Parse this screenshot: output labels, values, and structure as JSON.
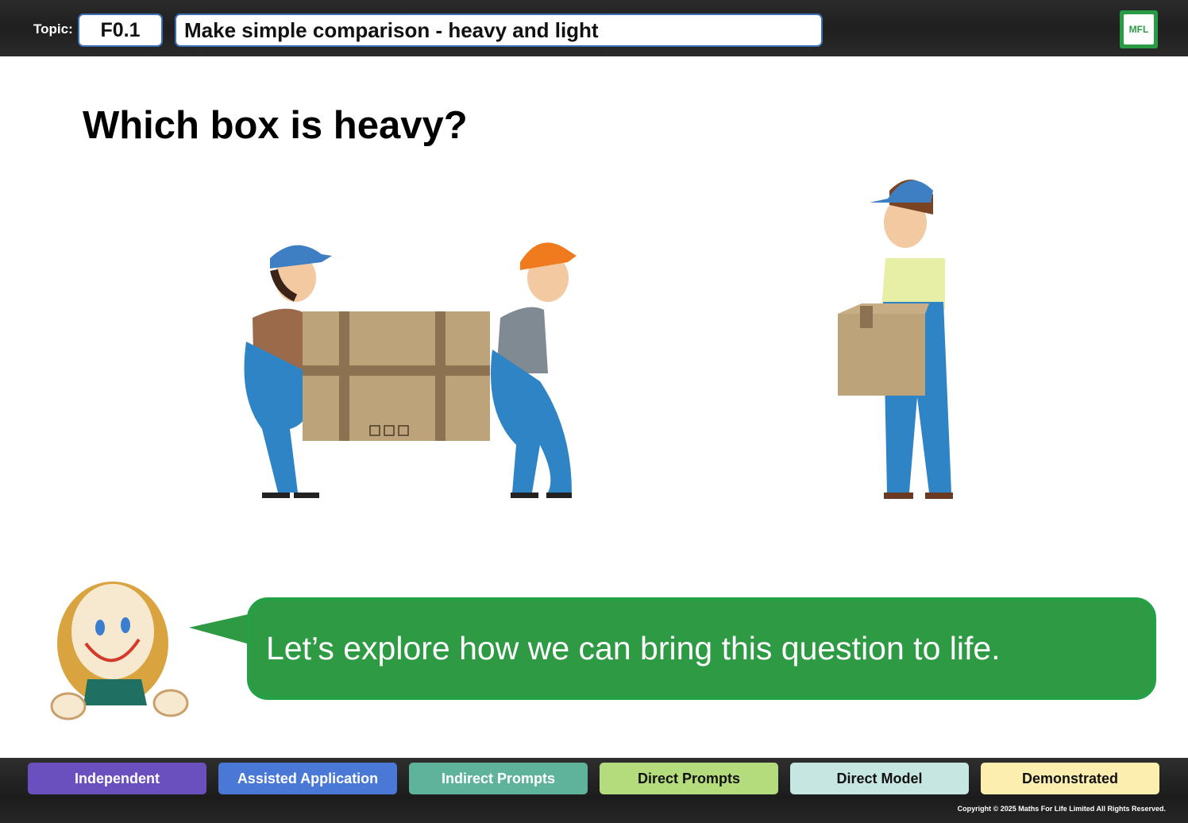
{
  "header": {
    "topic_label": "Topic:",
    "topic_code": "F0.1",
    "topic_title": "Make simple comparison - heavy and light",
    "logo_text": "MFL"
  },
  "main": {
    "question": "Which box is heavy?",
    "speech": "Let’s explore how we can bring this question to life."
  },
  "footer": {
    "levels": [
      {
        "label": "Independent",
        "color": "#6a4fbf",
        "text_color": "#ffffff"
      },
      {
        "label": "Assisted Application",
        "color": "#4a78d6",
        "text_color": "#ffffff"
      },
      {
        "label": "Indirect Prompts",
        "color": "#5fb39a",
        "text_color": "#ffffff"
      },
      {
        "label": "Direct Prompts",
        "color": "#b4dc7c",
        "text_color": "#111111"
      },
      {
        "label": "Direct Model",
        "color": "#c6e7e1",
        "text_color": "#111111"
      },
      {
        "label": "Demonstrated",
        "color": "#fbeeae",
        "text_color": "#111111"
      }
    ],
    "copyright": "Copyright © 2025 Maths For Life Limited All Rights Reserved."
  },
  "colors": {
    "accent_green": "#2e9a44",
    "frame_blue": "#3a6fb5"
  }
}
